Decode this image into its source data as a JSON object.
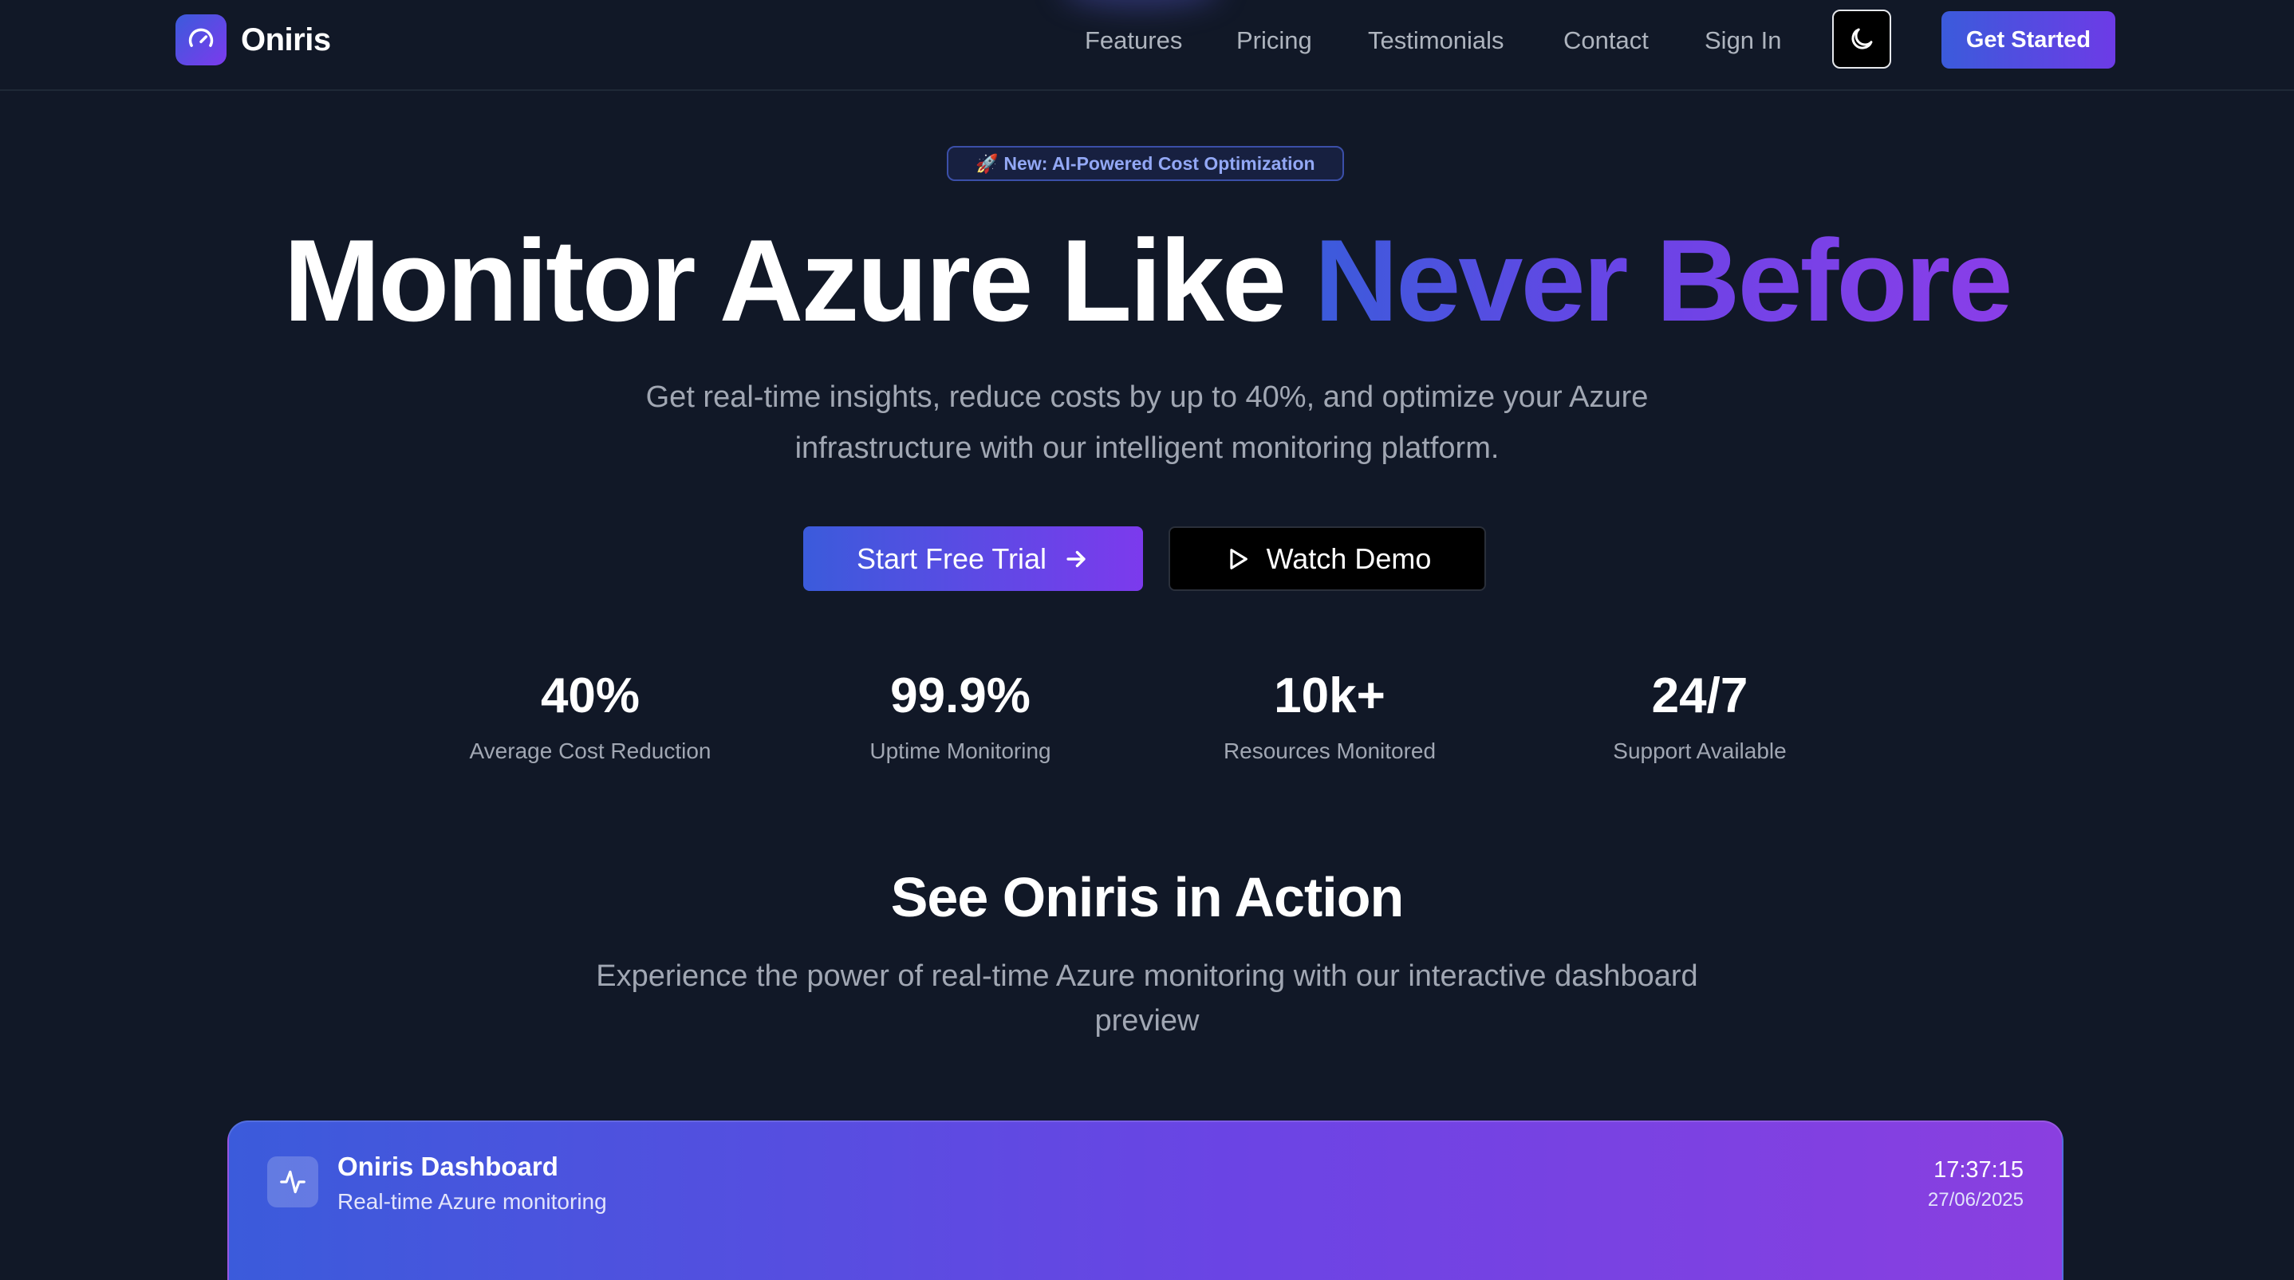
{
  "nav": {
    "brand": "Oniris",
    "links": [
      "Features",
      "Pricing",
      "Testimonials",
      "Contact",
      "Sign In"
    ],
    "get_started": "Get Started",
    "theme_icon": "moon-icon",
    "logo_icon": "speedometer-icon"
  },
  "hero": {
    "badge": "🚀 New: AI-Powered Cost Optimization",
    "headline_main": "Monitor Azure Like ",
    "headline_accent": "Never Before",
    "subtitle": "Get real-time insights, reduce costs by up to 40%, and optimize your Azure infrastructure with our intelligent monitoring platform.",
    "primary_cta": "Start Free Trial",
    "primary_cta_icon": "arrow-right-icon",
    "secondary_cta": "Watch Demo",
    "secondary_cta_icon": "play-icon"
  },
  "stats": [
    {
      "value": "40%",
      "label": "Average Cost Reduction"
    },
    {
      "value": "99.9%",
      "label": "Uptime Monitoring"
    },
    {
      "value": "10k+",
      "label": "Resources Monitored"
    },
    {
      "value": "24/7",
      "label": "Support Available"
    }
  ],
  "action": {
    "title": "See Oniris in Action",
    "subtitle": "Experience the power of real-time Azure monitoring with our interactive dashboard preview"
  },
  "dashboard": {
    "title": "Oniris Dashboard",
    "subtitle": "Real-time Azure monitoring",
    "time": "17:37:15",
    "date": "27/06/2025",
    "icon": "activity-icon"
  },
  "colors": {
    "background": "#111827",
    "accent_start": "#3b5bdb",
    "accent_end": "#7c3aed",
    "muted_text": "#a1a7b3"
  }
}
